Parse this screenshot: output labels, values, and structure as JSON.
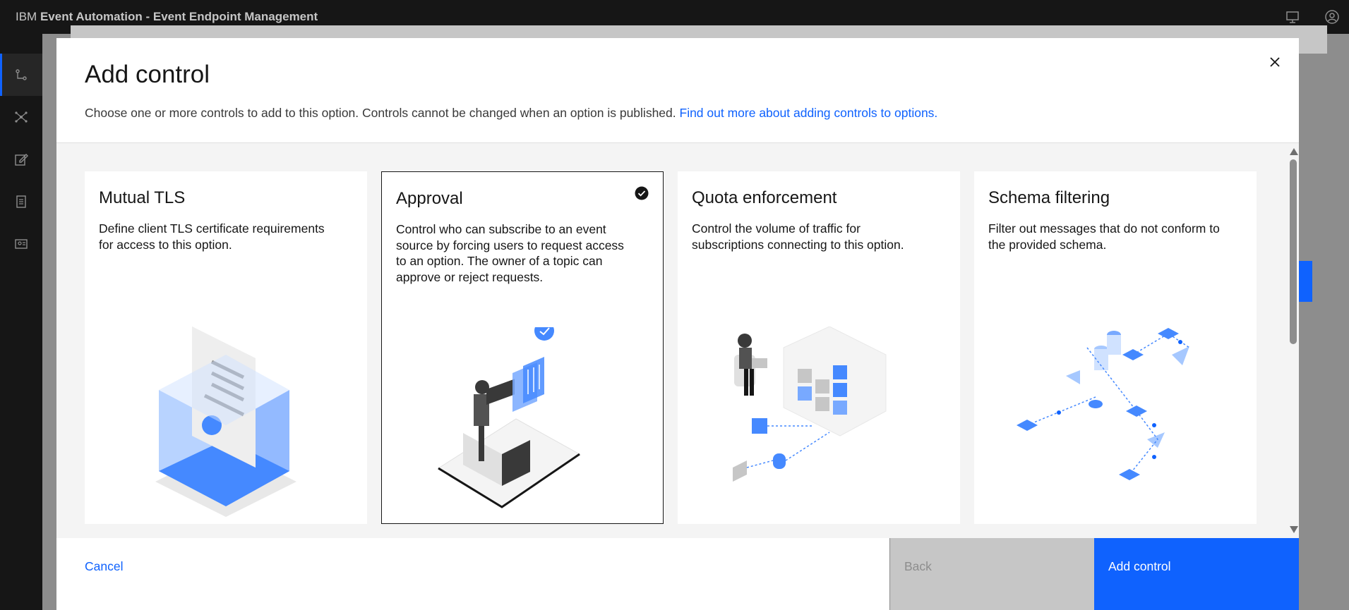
{
  "header": {
    "brand": "IBM",
    "product": "Event Automation - Event Endpoint Management"
  },
  "icons": {
    "rail": [
      "catalog-icon",
      "topology-icon",
      "edit-icon",
      "document-icon",
      "identity-icon"
    ],
    "header_right": [
      "desktop-icon",
      "user-icon"
    ]
  },
  "modal": {
    "title": "Add control",
    "description": "Choose one or more controls to add to this option. Controls cannot be changed when an option is published. ",
    "link": "Find out more about adding controls to options."
  },
  "tiles": [
    {
      "title": "Mutual TLS",
      "description": "Define client TLS certificate requirements for access to this option.",
      "selected": false
    },
    {
      "title": "Approval",
      "description": "Control who can subscribe to an event source by forcing users to request access to an option. The owner of a topic can approve or reject requests.",
      "selected": true
    },
    {
      "title": "Quota enforcement",
      "description": "Control the volume of traffic for subscriptions connecting to this option.",
      "selected": false
    },
    {
      "title": "Schema filtering",
      "description": "Filter out messages that do not conform to the provided schema.",
      "selected": false
    }
  ],
  "footer": {
    "cancel": "Cancel",
    "back": "Back",
    "add": "Add control"
  },
  "colors": {
    "accent": "#0f62fe",
    "header_bg": "#161616",
    "disabled": "#c6c6c6"
  }
}
